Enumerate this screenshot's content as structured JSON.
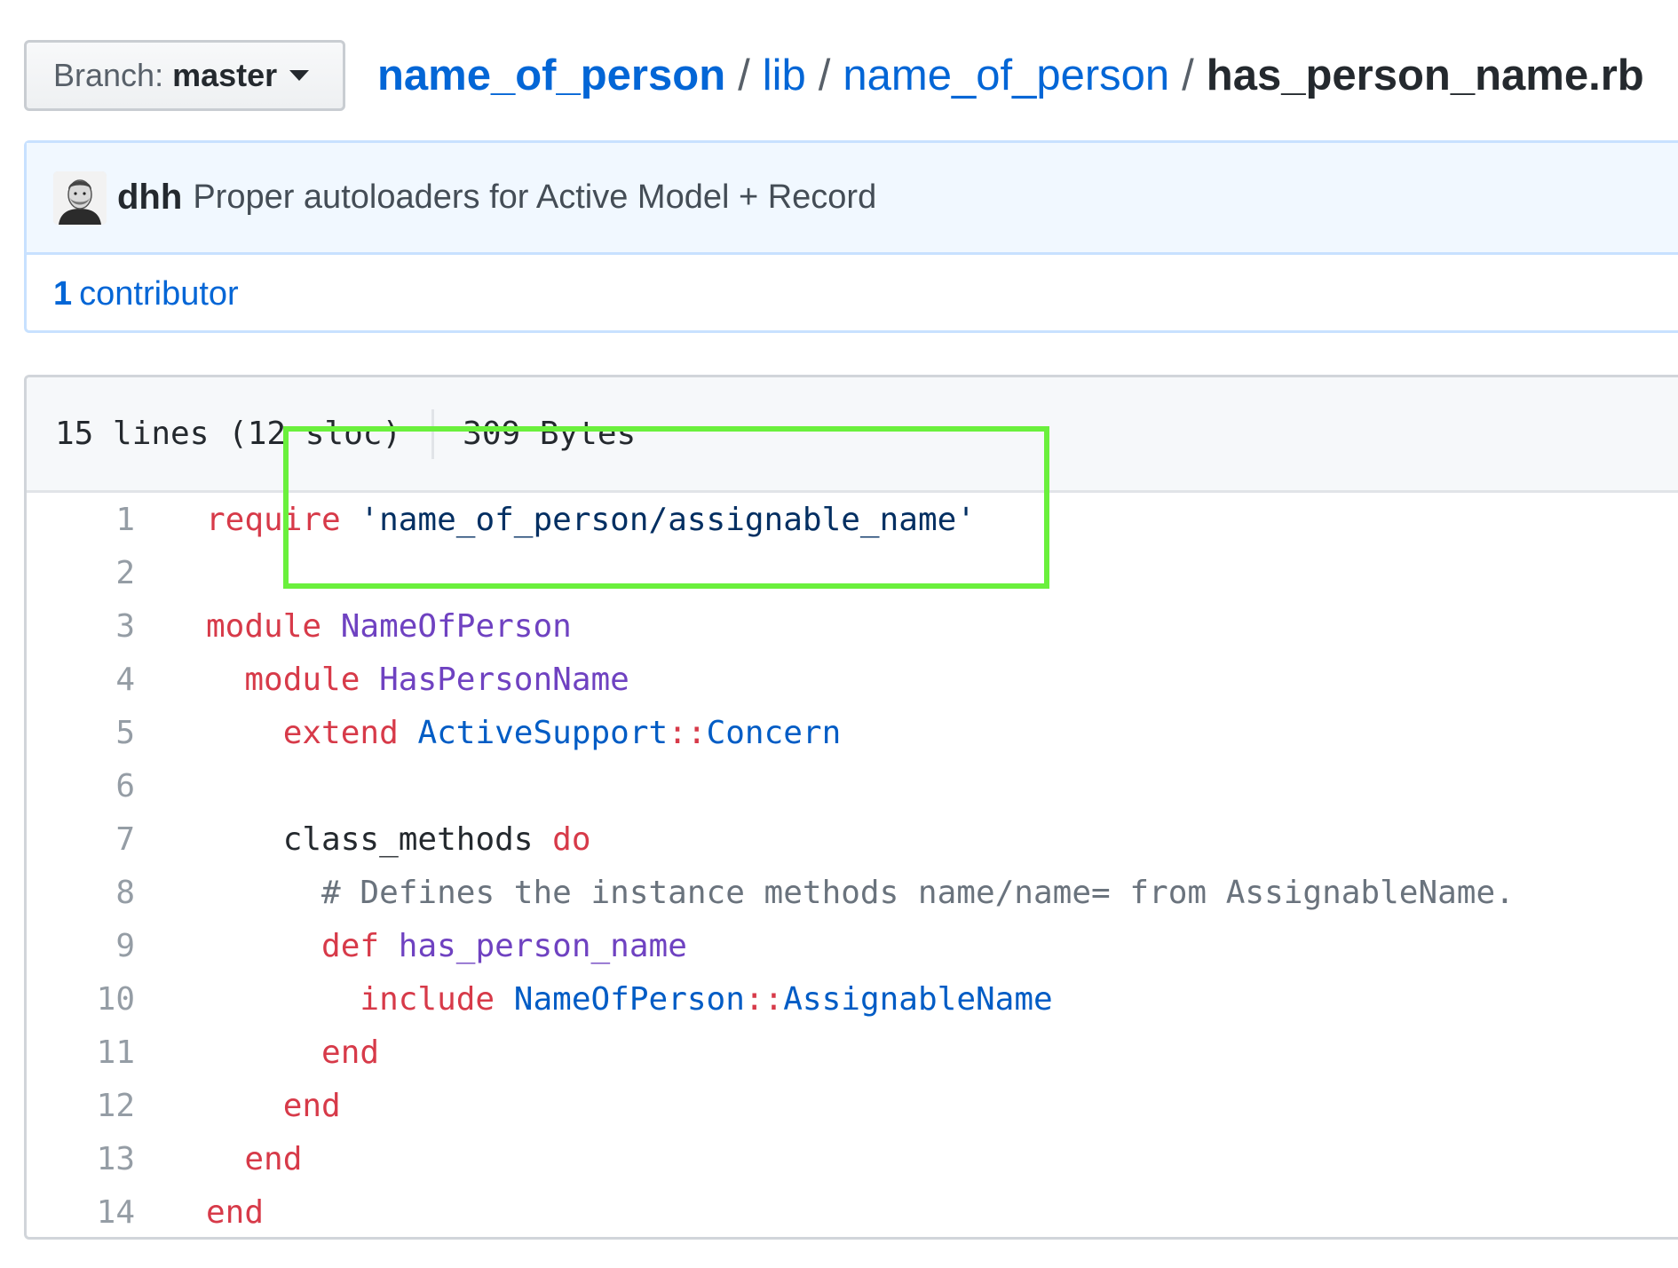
{
  "header": {
    "branch_label": "Branch:",
    "branch_name": "master",
    "breadcrumb": {
      "repo": "name_of_person",
      "sep1": "/",
      "dir1": "lib",
      "sep2": "/",
      "dir2": "name_of_person",
      "sep3": "/",
      "file": "has_person_name.rb"
    }
  },
  "commit": {
    "author": "dhh",
    "message": "Proper autoloaders for Active Model + Record",
    "contributor_count": "1",
    "contributor_label": "contributor"
  },
  "file": {
    "lines_info": "15 lines (12 sloc)",
    "size": "309 Bytes",
    "code_lines": [
      {
        "n": "1",
        "indent": "",
        "tokens": [
          {
            "t": "k",
            "v": "require"
          },
          {
            "t": "",
            "v": " "
          },
          {
            "t": "s",
            "v": "'name_of_person/assignable_name'"
          }
        ]
      },
      {
        "n": "2",
        "indent": "",
        "tokens": []
      },
      {
        "n": "3",
        "indent": "",
        "tokens": [
          {
            "t": "k",
            "v": "module"
          },
          {
            "t": "",
            "v": " "
          },
          {
            "t": "e",
            "v": "NameOfPerson"
          }
        ]
      },
      {
        "n": "4",
        "indent": "  ",
        "tokens": [
          {
            "t": "k",
            "v": "module"
          },
          {
            "t": "",
            "v": " "
          },
          {
            "t": "e",
            "v": "HasPersonName"
          }
        ]
      },
      {
        "n": "5",
        "indent": "    ",
        "tokens": [
          {
            "t": "k",
            "v": "extend"
          },
          {
            "t": "",
            "v": " "
          },
          {
            "t": "c1",
            "v": "ActiveSupport"
          },
          {
            "t": "k",
            "v": "::"
          },
          {
            "t": "c1",
            "v": "Concern"
          }
        ]
      },
      {
        "n": "6",
        "indent": "",
        "tokens": []
      },
      {
        "n": "7",
        "indent": "    ",
        "tokens": [
          {
            "t": "",
            "v": "class_methods "
          },
          {
            "t": "k",
            "v": "do"
          }
        ]
      },
      {
        "n": "8",
        "indent": "      ",
        "tokens": [
          {
            "t": "cm",
            "v": "# Defines the instance methods name/name= from AssignableName."
          }
        ]
      },
      {
        "n": "9",
        "indent": "      ",
        "tokens": [
          {
            "t": "k",
            "v": "def"
          },
          {
            "t": "",
            "v": " "
          },
          {
            "t": "e",
            "v": "has_person_name"
          }
        ]
      },
      {
        "n": "10",
        "indent": "        ",
        "tokens": [
          {
            "t": "k",
            "v": "include"
          },
          {
            "t": "",
            "v": " "
          },
          {
            "t": "c1",
            "v": "NameOfPerson"
          },
          {
            "t": "k",
            "v": "::"
          },
          {
            "t": "c1",
            "v": "AssignableName"
          }
        ]
      },
      {
        "n": "11",
        "indent": "      ",
        "tokens": [
          {
            "t": "k",
            "v": "end"
          }
        ]
      },
      {
        "n": "12",
        "indent": "    ",
        "tokens": [
          {
            "t": "k",
            "v": "end"
          }
        ]
      },
      {
        "n": "13",
        "indent": "  ",
        "tokens": [
          {
            "t": "k",
            "v": "end"
          }
        ]
      },
      {
        "n": "14",
        "indent": "",
        "tokens": [
          {
            "t": "k",
            "v": "end"
          }
        ]
      }
    ]
  },
  "colors": {
    "link": "#0366d6",
    "keyword": "#d73a49",
    "entity": "#6f42c1",
    "constant": "#005cc5",
    "string": "#032f62",
    "comment": "#6a737d",
    "highlight": "#6af03c"
  }
}
